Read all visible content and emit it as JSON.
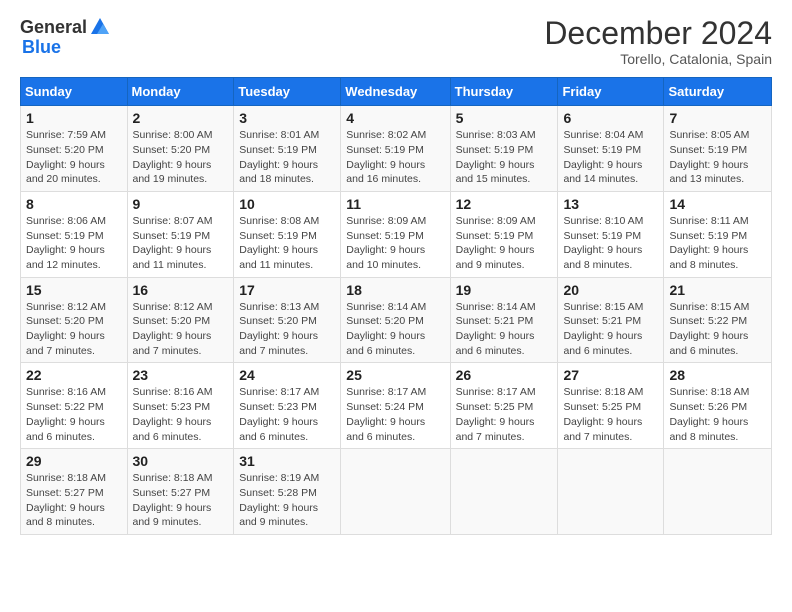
{
  "logo": {
    "general": "General",
    "blue": "Blue"
  },
  "title": "December 2024",
  "subtitle": "Torello, Catalonia, Spain",
  "calendar": {
    "headers": [
      "Sunday",
      "Monday",
      "Tuesday",
      "Wednesday",
      "Thursday",
      "Friday",
      "Saturday"
    ],
    "weeks": [
      [
        null,
        null,
        null,
        null,
        null,
        null,
        null
      ]
    ],
    "days": [
      {
        "date": "1",
        "col": 0,
        "sunrise": "Sunrise: 7:59 AM",
        "sunset": "Sunset: 5:20 PM",
        "daylight": "Daylight: 9 hours and 20 minutes."
      },
      {
        "date": "2",
        "col": 1,
        "sunrise": "Sunrise: 8:00 AM",
        "sunset": "Sunset: 5:20 PM",
        "daylight": "Daylight: 9 hours and 19 minutes."
      },
      {
        "date": "3",
        "col": 2,
        "sunrise": "Sunrise: 8:01 AM",
        "sunset": "Sunset: 5:19 PM",
        "daylight": "Daylight: 9 hours and 18 minutes."
      },
      {
        "date": "4",
        "col": 3,
        "sunrise": "Sunrise: 8:02 AM",
        "sunset": "Sunset: 5:19 PM",
        "daylight": "Daylight: 9 hours and 16 minutes."
      },
      {
        "date": "5",
        "col": 4,
        "sunrise": "Sunrise: 8:03 AM",
        "sunset": "Sunset: 5:19 PM",
        "daylight": "Daylight: 9 hours and 15 minutes."
      },
      {
        "date": "6",
        "col": 5,
        "sunrise": "Sunrise: 8:04 AM",
        "sunset": "Sunset: 5:19 PM",
        "daylight": "Daylight: 9 hours and 14 minutes."
      },
      {
        "date": "7",
        "col": 6,
        "sunrise": "Sunrise: 8:05 AM",
        "sunset": "Sunset: 5:19 PM",
        "daylight": "Daylight: 9 hours and 13 minutes."
      },
      {
        "date": "8",
        "col": 0,
        "sunrise": "Sunrise: 8:06 AM",
        "sunset": "Sunset: 5:19 PM",
        "daylight": "Daylight: 9 hours and 12 minutes."
      },
      {
        "date": "9",
        "col": 1,
        "sunrise": "Sunrise: 8:07 AM",
        "sunset": "Sunset: 5:19 PM",
        "daylight": "Daylight: 9 hours and 11 minutes."
      },
      {
        "date": "10",
        "col": 2,
        "sunrise": "Sunrise: 8:08 AM",
        "sunset": "Sunset: 5:19 PM",
        "daylight": "Daylight: 9 hours and 11 minutes."
      },
      {
        "date": "11",
        "col": 3,
        "sunrise": "Sunrise: 8:09 AM",
        "sunset": "Sunset: 5:19 PM",
        "daylight": "Daylight: 9 hours and 10 minutes."
      },
      {
        "date": "12",
        "col": 4,
        "sunrise": "Sunrise: 8:09 AM",
        "sunset": "Sunset: 5:19 PM",
        "daylight": "Daylight: 9 hours and 9 minutes."
      },
      {
        "date": "13",
        "col": 5,
        "sunrise": "Sunrise: 8:10 AM",
        "sunset": "Sunset: 5:19 PM",
        "daylight": "Daylight: 9 hours and 8 minutes."
      },
      {
        "date": "14",
        "col": 6,
        "sunrise": "Sunrise: 8:11 AM",
        "sunset": "Sunset: 5:19 PM",
        "daylight": "Daylight: 9 hours and 8 minutes."
      },
      {
        "date": "15",
        "col": 0,
        "sunrise": "Sunrise: 8:12 AM",
        "sunset": "Sunset: 5:20 PM",
        "daylight": "Daylight: 9 hours and 7 minutes."
      },
      {
        "date": "16",
        "col": 1,
        "sunrise": "Sunrise: 8:12 AM",
        "sunset": "Sunset: 5:20 PM",
        "daylight": "Daylight: 9 hours and 7 minutes."
      },
      {
        "date": "17",
        "col": 2,
        "sunrise": "Sunrise: 8:13 AM",
        "sunset": "Sunset: 5:20 PM",
        "daylight": "Daylight: 9 hours and 7 minutes."
      },
      {
        "date": "18",
        "col": 3,
        "sunrise": "Sunrise: 8:14 AM",
        "sunset": "Sunset: 5:20 PM",
        "daylight": "Daylight: 9 hours and 6 minutes."
      },
      {
        "date": "19",
        "col": 4,
        "sunrise": "Sunrise: 8:14 AM",
        "sunset": "Sunset: 5:21 PM",
        "daylight": "Daylight: 9 hours and 6 minutes."
      },
      {
        "date": "20",
        "col": 5,
        "sunrise": "Sunrise: 8:15 AM",
        "sunset": "Sunset: 5:21 PM",
        "daylight": "Daylight: 9 hours and 6 minutes."
      },
      {
        "date": "21",
        "col": 6,
        "sunrise": "Sunrise: 8:15 AM",
        "sunset": "Sunset: 5:22 PM",
        "daylight": "Daylight: 9 hours and 6 minutes."
      },
      {
        "date": "22",
        "col": 0,
        "sunrise": "Sunrise: 8:16 AM",
        "sunset": "Sunset: 5:22 PM",
        "daylight": "Daylight: 9 hours and 6 minutes."
      },
      {
        "date": "23",
        "col": 1,
        "sunrise": "Sunrise: 8:16 AM",
        "sunset": "Sunset: 5:23 PM",
        "daylight": "Daylight: 9 hours and 6 minutes."
      },
      {
        "date": "24",
        "col": 2,
        "sunrise": "Sunrise: 8:17 AM",
        "sunset": "Sunset: 5:23 PM",
        "daylight": "Daylight: 9 hours and 6 minutes."
      },
      {
        "date": "25",
        "col": 3,
        "sunrise": "Sunrise: 8:17 AM",
        "sunset": "Sunset: 5:24 PM",
        "daylight": "Daylight: 9 hours and 6 minutes."
      },
      {
        "date": "26",
        "col": 4,
        "sunrise": "Sunrise: 8:17 AM",
        "sunset": "Sunset: 5:25 PM",
        "daylight": "Daylight: 9 hours and 7 minutes."
      },
      {
        "date": "27",
        "col": 5,
        "sunrise": "Sunrise: 8:18 AM",
        "sunset": "Sunset: 5:25 PM",
        "daylight": "Daylight: 9 hours and 7 minutes."
      },
      {
        "date": "28",
        "col": 6,
        "sunrise": "Sunrise: 8:18 AM",
        "sunset": "Sunset: 5:26 PM",
        "daylight": "Daylight: 9 hours and 8 minutes."
      },
      {
        "date": "29",
        "col": 0,
        "sunrise": "Sunrise: 8:18 AM",
        "sunset": "Sunset: 5:27 PM",
        "daylight": "Daylight: 9 hours and 8 minutes."
      },
      {
        "date": "30",
        "col": 1,
        "sunrise": "Sunrise: 8:18 AM",
        "sunset": "Sunset: 5:27 PM",
        "daylight": "Daylight: 9 hours and 9 minutes."
      },
      {
        "date": "31",
        "col": 2,
        "sunrise": "Sunrise: 8:19 AM",
        "sunset": "Sunset: 5:28 PM",
        "daylight": "Daylight: 9 hours and 9 minutes."
      }
    ]
  }
}
